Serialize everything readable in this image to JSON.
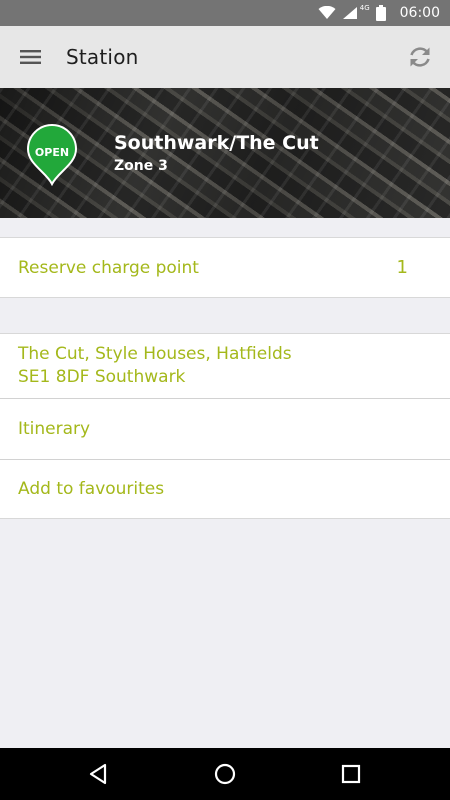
{
  "status_bar": {
    "network_type": "4G",
    "time": "06:00"
  },
  "app_bar": {
    "title": "Station",
    "menu_icon": "hamburger-menu-icon",
    "refresh_icon": "refresh-icon"
  },
  "station": {
    "status": "OPEN",
    "status_color": "#22a83a",
    "name": "Southwark/The Cut",
    "zone": "Zone 3"
  },
  "reserve": {
    "label": "Reserve charge point",
    "count": "1"
  },
  "details": {
    "address_line1": "The Cut, Style Houses, Hatfields",
    "address_line2": "SE1 8DF Southwark",
    "itinerary": "Itinerary",
    "favourites": "Add to favourites"
  },
  "colors": {
    "accent": "#a4b81b",
    "app_bar_bg": "#e7e7e7",
    "status_bar_bg": "#747474",
    "page_bg": "#efeff3"
  }
}
